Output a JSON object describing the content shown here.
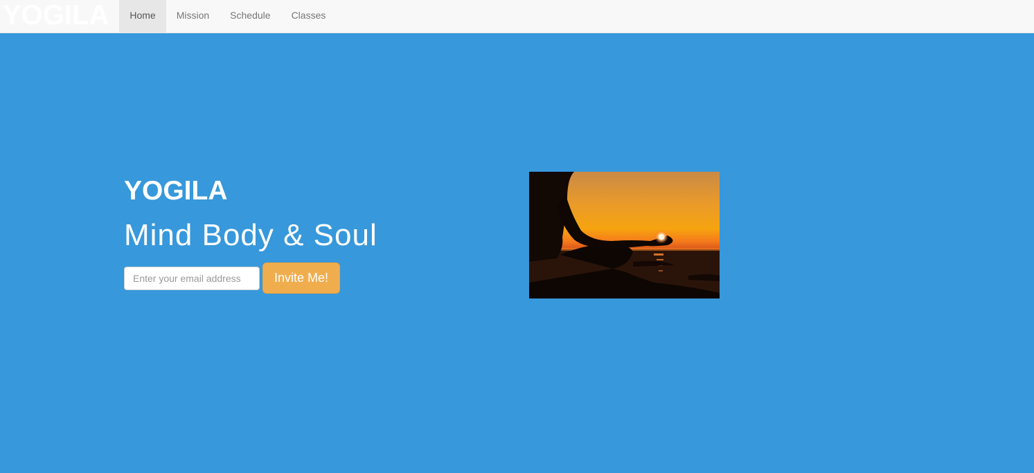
{
  "navbar": {
    "brand": "YOGILA",
    "items": [
      {
        "label": "Home",
        "active": true
      },
      {
        "label": "Mission",
        "active": false
      },
      {
        "label": "Schedule",
        "active": false
      },
      {
        "label": "Classes",
        "active": false
      }
    ]
  },
  "hero": {
    "title": "YOGILA",
    "tagline": "Mind Body & Soul",
    "email_placeholder": "Enter your email address",
    "email_value": "",
    "invite_label": "Invite Me!",
    "image_icon": "meditation-sunset-photo"
  },
  "colors": {
    "background": "#3798db",
    "navbar": "#f8f8f8",
    "button": "#f0ad4e"
  }
}
